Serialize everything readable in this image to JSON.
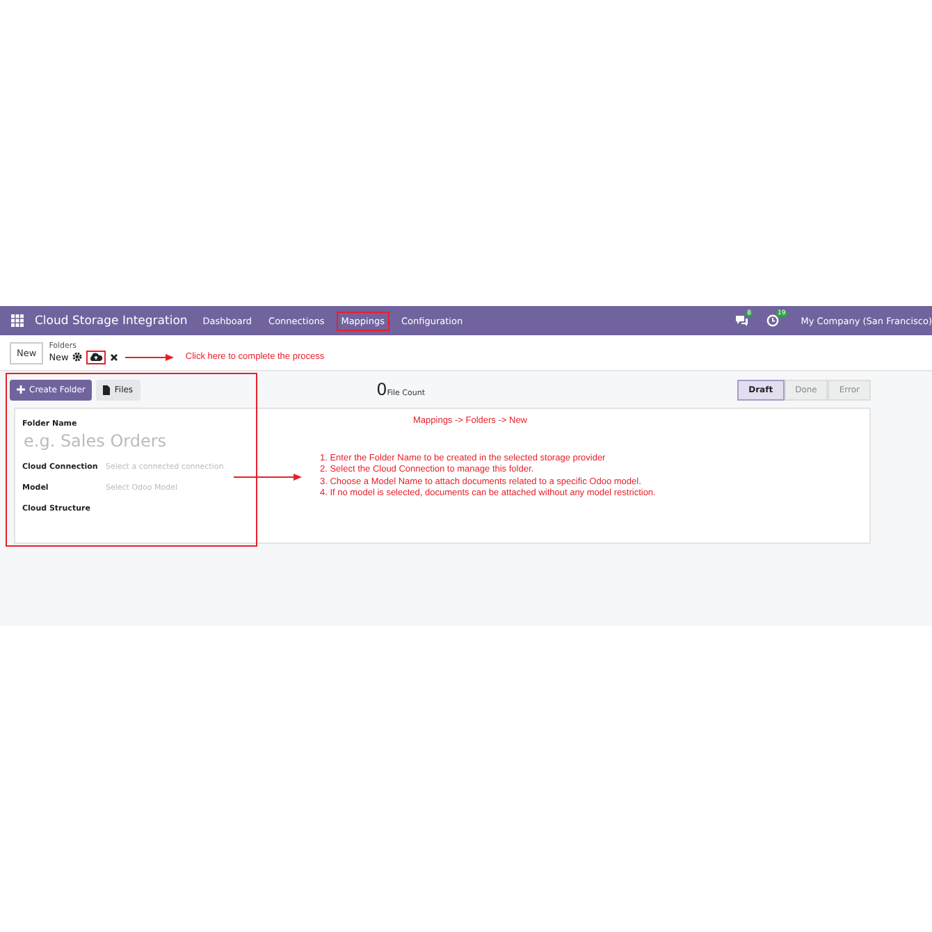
{
  "navbar": {
    "app_name": "Cloud Storage Integration",
    "menu": [
      {
        "label": "Dashboard",
        "annotated": false
      },
      {
        "label": "Connections",
        "annotated": false
      },
      {
        "label": "Mappings",
        "annotated": true
      },
      {
        "label": "Configuration",
        "annotated": false
      }
    ],
    "chat_badge": "8",
    "activity_badge": "19",
    "company": "My Company (San Francisco)"
  },
  "control_panel": {
    "new_button": "New",
    "breadcrumb": "Folders",
    "record": "New",
    "save_annotated": true
  },
  "actions": [
    {
      "label": "Create Folder",
      "kind": "primary"
    },
    {
      "label": "Files",
      "kind": "secondary"
    }
  ],
  "stat": {
    "value": "0",
    "label": "File Count"
  },
  "statusbar": [
    {
      "label": "Draft",
      "selected": true
    },
    {
      "label": "Done",
      "selected": false
    },
    {
      "label": "Error",
      "selected": false
    }
  ],
  "form": {
    "title_label": "Folder Name",
    "title_placeholder": "e.g. Sales Orders",
    "fields": [
      {
        "label": "Cloud Connection",
        "placeholder": "Select a connected connection"
      },
      {
        "label": "Model",
        "placeholder": "Select Odoo Model"
      },
      {
        "label": "Cloud Structure"
      }
    ]
  },
  "annotations": {
    "hint": "Click here to complete the process",
    "path": "Mappings -> Folders -> New",
    "steps": [
      "1. Enter the Folder Name to be created in the selected storage provider",
      "2. Select the Cloud Connection to manage this folder.",
      "3. Choose a Model Name to attach documents related to a specific Odoo model.",
      "4. If no model is selected, documents can be attached without any model restriction."
    ]
  }
}
